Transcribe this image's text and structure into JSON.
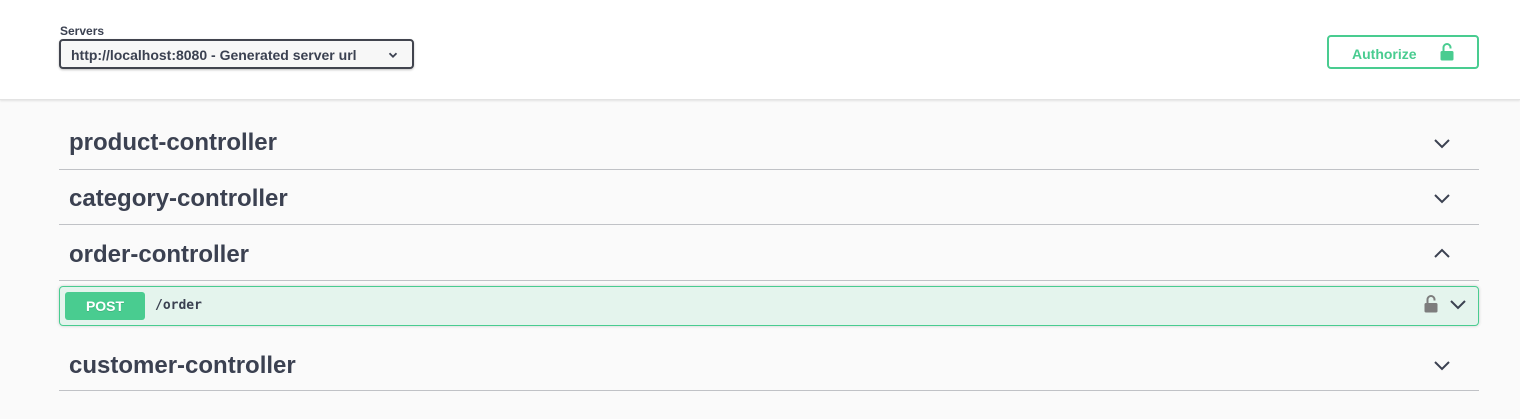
{
  "header": {
    "servers_label": "Servers",
    "server_selected": "http://localhost:8080 - Generated server url",
    "authorize_label": "Authorize"
  },
  "tags": [
    {
      "name": "product-controller",
      "expanded": false
    },
    {
      "name": "category-controller",
      "expanded": false
    },
    {
      "name": "order-controller",
      "expanded": true
    },
    {
      "name": "customer-controller",
      "expanded": false
    }
  ],
  "operations": [
    {
      "method": "POST",
      "path": "/order",
      "tag": "order-controller"
    }
  ],
  "colors": {
    "post_green": "#49cc90",
    "text_dark": "#3b4151",
    "page_bg": "#fafafa",
    "lock_gray": "#7d7d7d"
  },
  "icons": {
    "select_chevron": "chevron-down-icon",
    "authorize": "lock-open-icon",
    "collapsed": "chevron-down-icon",
    "expanded": "chevron-up-icon",
    "op_lock": "lock-open-icon"
  }
}
